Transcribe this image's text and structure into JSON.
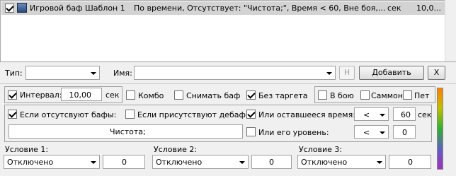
{
  "list": {
    "rows": [
      {
        "checked": true,
        "name": "Игровой баф Шаблон 1",
        "condition": "По времени, Отсутствует: \"Чистота;\", Время < 60, Вне боя,...",
        "unit": "сек",
        "value": "10,0..."
      }
    ]
  },
  "filter": {
    "type_label": "Тип:",
    "type_value": "",
    "name_label": "Имя:",
    "name_value": "",
    "h_button": "H",
    "add_button": "Добавить",
    "x_button": "X"
  },
  "options": {
    "interval_label": "Интервал:",
    "interval_checked": true,
    "interval_value": "10,00",
    "interval_unit": "сек",
    "combo_label": "Комбо",
    "combo_checked": false,
    "remove_buff_label": "Снимать баф",
    "remove_buff_checked": false,
    "no_target_label": "Без таргета",
    "no_target_checked": true,
    "in_combat_label": "В бою",
    "in_combat_checked": false,
    "summon_label": "Саммон",
    "summon_checked": false,
    "pet_label": "Пет",
    "pet_checked": false
  },
  "conditions": {
    "absent_buffs_label": "Если отсутсвуют бафы:",
    "absent_buffs_checked": true,
    "present_debuffs_label": "Если присутствуют дебафы:",
    "present_debuffs_checked": false,
    "remaining_time_label": "Или оставшееся время:",
    "remaining_time_checked": true,
    "remaining_time_op": "<",
    "remaining_time_value": "60",
    "remaining_time_unit": "сек",
    "buffs_text": "Чистота;",
    "level_label": "Или его уровень:",
    "level_checked": false,
    "level_op": "<",
    "level_value": "0"
  },
  "bottom": {
    "cond1_label": "Условие 1:",
    "cond1_value": "Отключено",
    "cond1_num": "0",
    "cond2_label": "Условие 2:",
    "cond2_value": "Отключено",
    "cond2_num": "0",
    "cond3_label": "Условие 3:",
    "cond3_value": "Отключено",
    "cond3_num": "0"
  }
}
